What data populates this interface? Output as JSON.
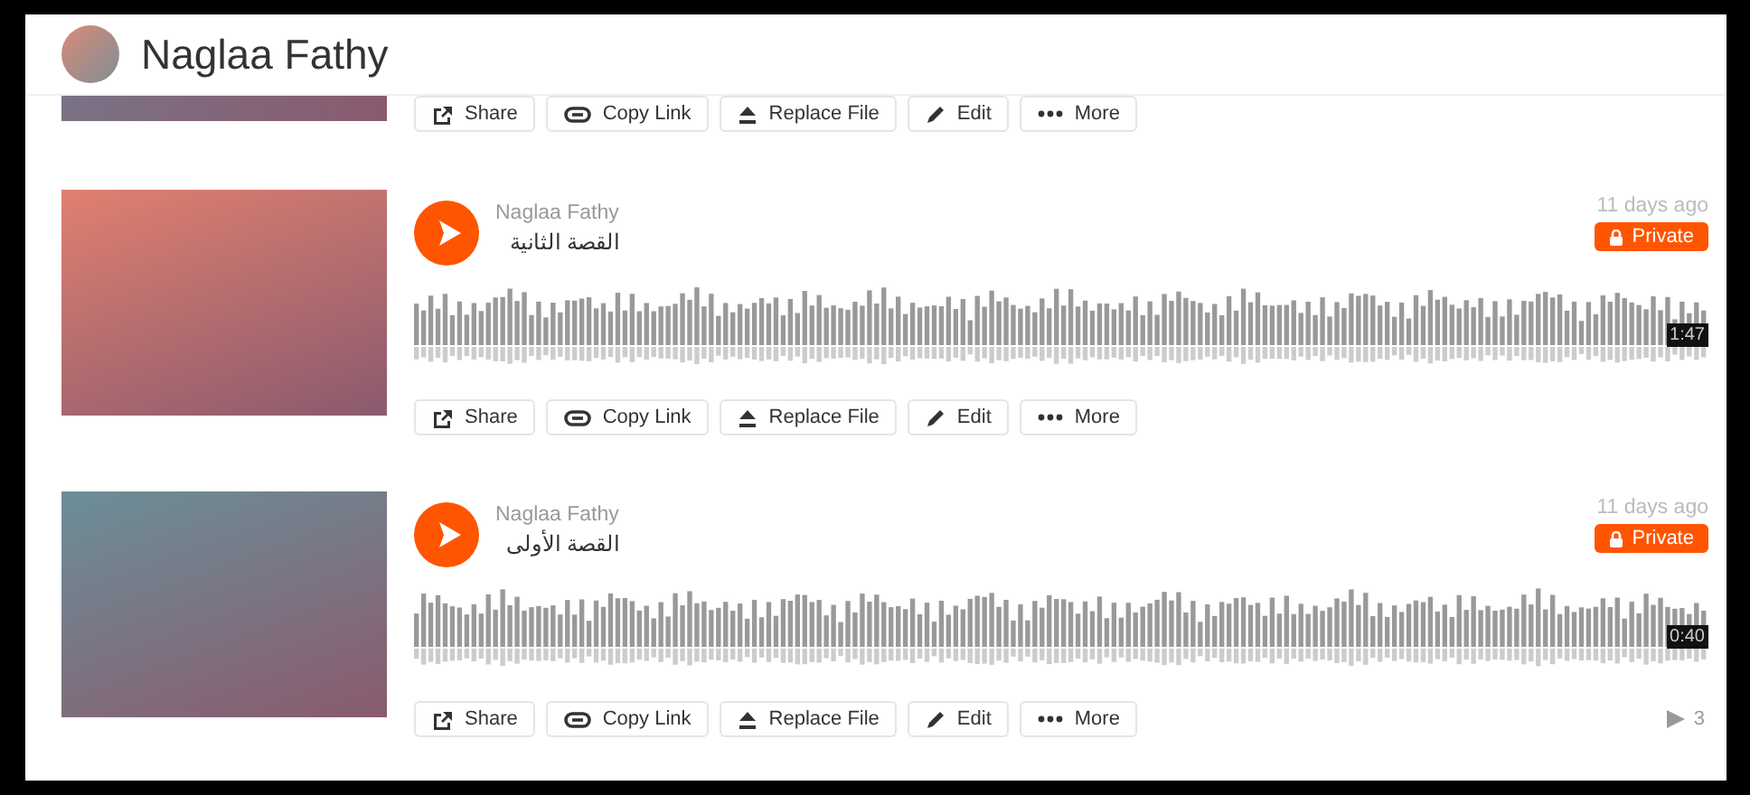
{
  "header": {
    "name": "Naglaa Fathy"
  },
  "partial_track": {
    "actions": [
      {
        "kind": "share",
        "label": "Share"
      },
      {
        "kind": "link",
        "label": "Copy Link"
      },
      {
        "kind": "upload",
        "label": "Replace File"
      },
      {
        "kind": "edit",
        "label": "Edit"
      },
      {
        "kind": "more",
        "label": "More"
      }
    ]
  },
  "tracks": [
    {
      "uploader": "Naglaa Fathy",
      "title": "القصة الثانية",
      "time_ago": "11 days ago",
      "badge": "Private",
      "duration": "1:47",
      "actions": [
        {
          "kind": "share",
          "label": "Share"
        },
        {
          "kind": "link",
          "label": "Copy Link"
        },
        {
          "kind": "upload",
          "label": "Replace File"
        },
        {
          "kind": "edit",
          "label": "Edit"
        },
        {
          "kind": "more",
          "label": "More"
        }
      ]
    },
    {
      "uploader": "Naglaa Fathy",
      "title": "القصة الأولى",
      "time_ago": "11 days ago",
      "badge": "Private",
      "duration": "0:40",
      "plays": "3",
      "actions": [
        {
          "kind": "share",
          "label": "Share"
        },
        {
          "kind": "link",
          "label": "Copy Link"
        },
        {
          "kind": "upload",
          "label": "Replace File"
        },
        {
          "kind": "edit",
          "label": "Edit"
        },
        {
          "kind": "more",
          "label": "More"
        }
      ]
    }
  ]
}
